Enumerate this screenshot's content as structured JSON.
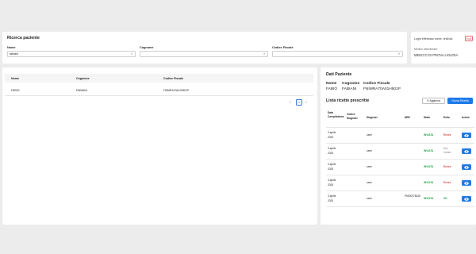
{
  "search": {
    "title": "Ricerca paziente",
    "nome_label": "Nome",
    "nome_value": "fabiani",
    "cognome_label": "Cognome",
    "cognome_value": "",
    "cf_label": "Codice Fiscale",
    "cf_value": ""
  },
  "login": {
    "text": "Login effettuato come: drsilva1",
    "exit_label": "Esci",
    "medico_label": "Medico selezionato:",
    "medico_value": "MEDICO DI PROVA LIGURIA"
  },
  "results": {
    "headers": [
      "Nome",
      "Cognome",
      "Codice Fiscale"
    ],
    "row": [
      "FABIO",
      "FABIANI",
      "FNIMRA70A01H501P"
    ],
    "pagination": {
      "prev": "<",
      "current": "1",
      "next": ">"
    }
  },
  "patient": {
    "title": "Dati Paziente",
    "nome_label": "Nome",
    "nome_value": "FABIO",
    "cognome_label": "Cognome",
    "cognome_value": "FABIANI",
    "cf_label": "Codice Fiscale",
    "cf_value": "FNIMRA70A01H501P"
  },
  "prescriptions": {
    "title": "Lista ricette prescritte",
    "refresh_label": "Aggiorna",
    "new_label": "Nuova Ricetta",
    "headers": {
      "data": "Data Compilazione",
      "codice": "Codice Diagnosi",
      "diagnosi": "Diagnosi",
      "nre": "NRE",
      "stato": "Stato",
      "esito": "Esito",
      "azioni": "Azioni"
    },
    "rows": [
      {
        "date1": "3 aprile",
        "date2": "2025",
        "diagnosi": "cane",
        "nre": "",
        "stato": "INVIATA",
        "esito": "Errore",
        "esito_type": "err"
      },
      {
        "date1": "3 aprile",
        "date2": "2025",
        "diagnosi": "cane",
        "nre": "",
        "stato": "INVIATA",
        "esito": "Non inviata",
        "esito_type": "muted"
      },
      {
        "date1": "3 aprile",
        "date2": "2025",
        "diagnosi": "cane",
        "nre": "",
        "stato": "INVIATA",
        "esito": "Errore",
        "esito_type": "err"
      },
      {
        "date1": "3 aprile",
        "date2": "2025",
        "diagnosi": "cane",
        "nre": "",
        "stato": "INVIATA",
        "esito": "Errore",
        "esito_type": "err"
      },
      {
        "date1": "3 aprile",
        "date2": "2025",
        "diagnosi": "cane",
        "nre": "P5000278245",
        "stato": "INVIATA",
        "esito": "OK",
        "esito_type": "ok"
      }
    ]
  },
  "icons": {
    "search": "search-icon",
    "refresh": "refresh-icon",
    "view": "eye-icon"
  },
  "colors": {
    "primary": "#1e7ae8",
    "success": "#24a148",
    "danger": "#d64545"
  }
}
